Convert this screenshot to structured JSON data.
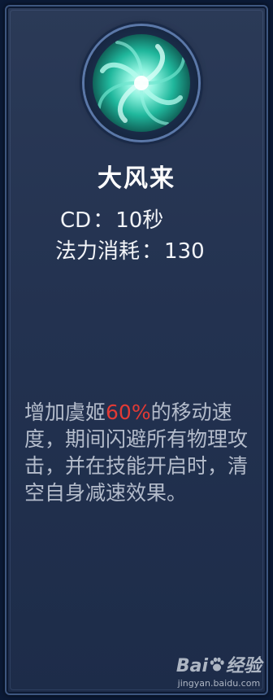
{
  "skill": {
    "icon": "wind-vortex-icon",
    "name": "大风来",
    "cd_label": "CD",
    "cd_value": "10秒",
    "cost_label": "法力消耗",
    "cost_value": "130",
    "separator": "：",
    "description_before": "增加虞姬",
    "description_highlight": "60%",
    "description_after": "的移动速度，期间闪避所有物理攻击，并在技能开启时，清空自身减速效果。"
  },
  "watermark": {
    "brand_left": "Bai",
    "brand_right": "经验",
    "url": "jingyan.baidu.com"
  },
  "colors": {
    "highlight": "#e23a35",
    "description": "#b4bccb",
    "title": "#ffffff",
    "icon_primary": "#3fe0c6"
  }
}
